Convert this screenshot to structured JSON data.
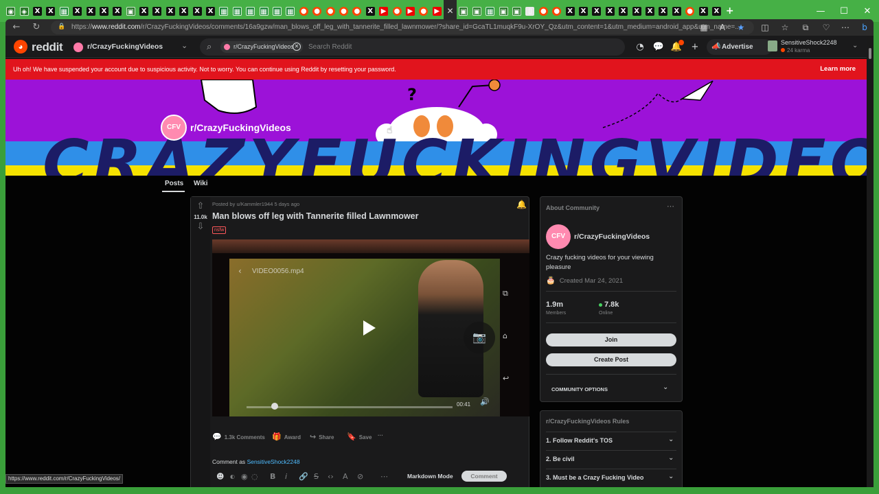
{
  "browser": {
    "tabs": [
      "x",
      "x",
      "sheet",
      "x",
      "x",
      "x",
      "x",
      "gen",
      "x",
      "x",
      "x",
      "x",
      "x",
      "x",
      "sheet",
      "sheet",
      "sheet",
      "sheet",
      "sheet",
      "sheet",
      "rd",
      "rd",
      "rd",
      "rd",
      "rd",
      "x",
      "yt",
      "rd",
      "yt",
      "rd",
      "yt",
      "active",
      "gen",
      "gen",
      "sheet",
      "gen",
      "gen",
      "doc",
      "rd",
      "rd",
      "x",
      "x",
      "x",
      "x",
      "x",
      "x",
      "x",
      "x",
      "x",
      "rd",
      "x",
      "x"
    ],
    "active_tab_close": "✕",
    "new_tab": "+",
    "window_controls": [
      "—",
      "☐",
      "✕"
    ],
    "url_prefix": "https://",
    "url_host": "www.reddit.com",
    "url_path": "/r/CrazyFuckingVideos/comments/16a9gzw/man_blows_off_leg_with_tannerite_filled_lawnmower/?share_id=GcaTL1muqkF9u-XrOY_Qz&utm_content=1&utm_medium=android_app&utm_name=...",
    "status_url": "https://www.reddit.com/r/CrazyFuckingVideos/"
  },
  "reddit_header": {
    "logo_text": "reddit",
    "community_name": "r/CrazyFuckingVideos",
    "search_chip": "r/CrazyFuckingVideos",
    "search_placeholder": "Search Reddit",
    "advertise_label": "Advertise",
    "username": "SensitiveShock2248",
    "karma": "24 karma",
    "notification_count": "9"
  },
  "alert": {
    "text": "Uh oh! We have suspended your account due to suspicious activity. Not to worry. You can continue using Reddit by resetting your password.",
    "link_label": "Learn more"
  },
  "community_banner": {
    "big_text": "CRAZYFUCKINGVIDEOS",
    "avatar_text": "CFV",
    "name": "r/CrazyFuckingVideos",
    "tabs": [
      "Posts",
      "Wiki"
    ]
  },
  "post": {
    "vote_count": "11.0k",
    "meta": "Posted by u/Kammler1944 5 days ago",
    "title": "Man blows off leg with Tannerite filled Lawnmower",
    "flair": "nsfw",
    "video_filename": "VIDEO0056.mp4",
    "video_time": "00:41",
    "actions": {
      "comments": "1.3k Comments",
      "award": "Award",
      "share": "Share",
      "save": "Save",
      "more": "···"
    },
    "comment_as_prefix": "Comment as",
    "comment_as_user": "SensitiveShock2248",
    "markdown_mode": "Markdown Mode",
    "comment_button": "Comment"
  },
  "about": {
    "heading": "About Community",
    "avatar_text": "CFV",
    "name": "r/CrazyFuckingVideos",
    "description": "Crazy fucking videos for your viewing pleasure",
    "created": "Created Mar 24, 2021",
    "members_value": "1.9m",
    "members_label": "Members",
    "online_value": "7.8k",
    "online_label": "Online",
    "join_label": "Join",
    "create_post_label": "Create Post",
    "community_options": "COMMUNITY OPTIONS"
  },
  "rules": {
    "heading": "r/CrazyFuckingVideos Rules",
    "items": [
      "1. Follow Reddit's TOS",
      "2. Be civil",
      "3. Must be a Crazy Fucking Video"
    ]
  },
  "colors": {
    "frame_green": "#3a9f3a",
    "alert_red": "#e1141d",
    "banner_purple": "#9c12d8",
    "reddit_orange": "#ff4500",
    "online_green": "#46d160"
  }
}
